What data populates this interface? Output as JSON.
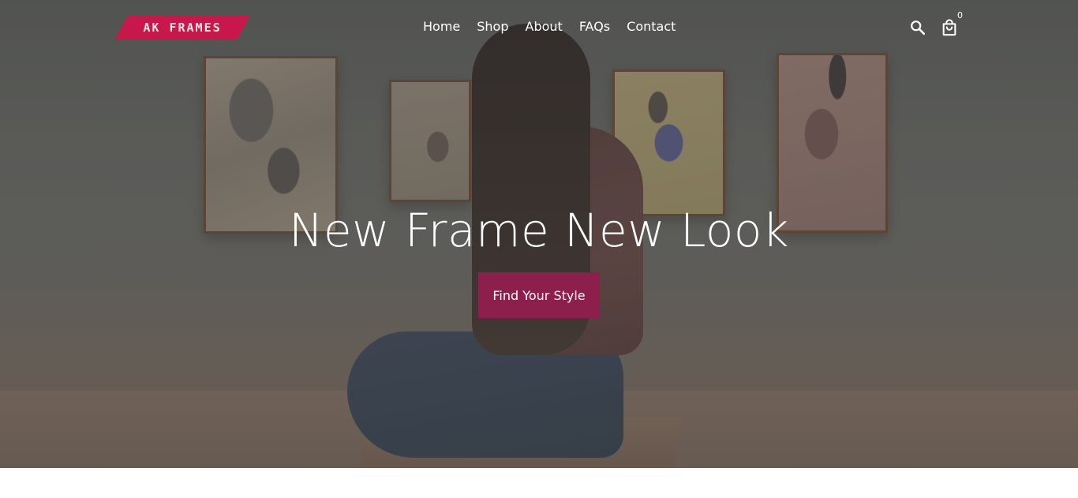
{
  "logo": {
    "text": "AK FRAMES",
    "color": "#c8184b"
  },
  "nav": {
    "items": [
      "Home",
      "Shop",
      "About",
      "FAQs",
      "Contact"
    ]
  },
  "header": {
    "search_icon": "search-icon",
    "cart_icon": "shopping-bag-icon",
    "cart_count": "0"
  },
  "hero": {
    "headline": "New Frame New Look",
    "cta_label": "Find Your Style",
    "cta_color": "#8c1f4b"
  }
}
